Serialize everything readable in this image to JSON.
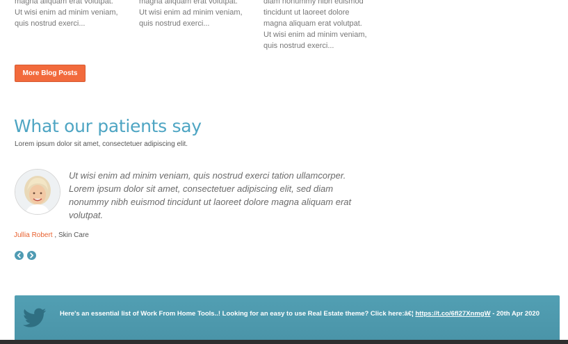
{
  "blog": {
    "col1": [
      "magna aliquam erat volutpat.",
      "Ut wisi enim ad minim veniam,",
      "quis nostrud exerci..."
    ],
    "col2": [
      "magna aliquam erat volutpat.",
      "Ut wisi enim ad minim veniam,",
      "quis nostrud exerci..."
    ],
    "col3": [
      "diam nonummy nibh euismod",
      "tincidunt ut laoreet dolore",
      "magna aliquam erat volutpat.",
      "Ut wisi enim ad minim veniam,",
      "quis nostrud exerci..."
    ],
    "more_label": "More Blog Posts"
  },
  "testimonials": {
    "title": "What our patients say",
    "subtitle": "Lorem ipsum dolor sit amet, consectetuer adipiscing elit.",
    "quote": "Ut wisi enim ad minim veniam, quis nostrud exerci tation ullamcorper. Lorem ipsum dolor sit amet, consectetuer adipiscing elit, sed diam nonummy nibh euismod tincidunt ut laoreet dolore magna aliquam erat volutpat.",
    "author_name": "Jullia Robert",
    "author_separator": " , ",
    "author_role": "Skin Care"
  },
  "twitter": {
    "text": "Here's an essential list of Work From Home Tools..! Looking for an easy to use Real Estate theme? Click here:â€¦ ",
    "link": "https://t.co/6fI27XnmgW",
    "date_suffix": " - 20th Apr 2020"
  },
  "icons": {
    "prev": "chevron-left-icon",
    "next": "chevron-right-icon",
    "twitter": "twitter-bird-icon"
  },
  "colors": {
    "accent_orange": "#f26a3c",
    "heading_blue": "#4ea5c3",
    "twitter_bar": "#4f9bb0",
    "nav_arrow": "#4f9bb3"
  }
}
